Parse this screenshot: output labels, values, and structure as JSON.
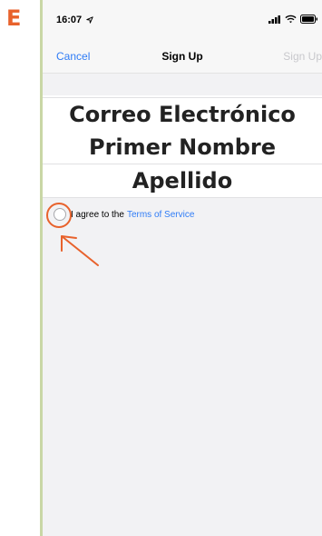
{
  "figure": {
    "label": "E"
  },
  "status_bar": {
    "time": "16:07",
    "icons": [
      "location-arrow-icon",
      "signal-icon",
      "wifi-icon",
      "battery-icon"
    ]
  },
  "nav": {
    "cancel_label": "Cancel",
    "title": "Sign Up",
    "signup_label": "Sign Up"
  },
  "form": {
    "fields": [
      {
        "label": "Correo Electrónico"
      },
      {
        "label": "Primer Nombre"
      },
      {
        "label": "Apellido"
      }
    ]
  },
  "agreement": {
    "text": "I agree to the",
    "link": "Terms of Service",
    "checked": false
  },
  "colors": {
    "accent": "#2f7cf6",
    "annotation": "#e8622c",
    "disabled": "#c8c8cc",
    "frame_border": "#c9d7a6"
  }
}
